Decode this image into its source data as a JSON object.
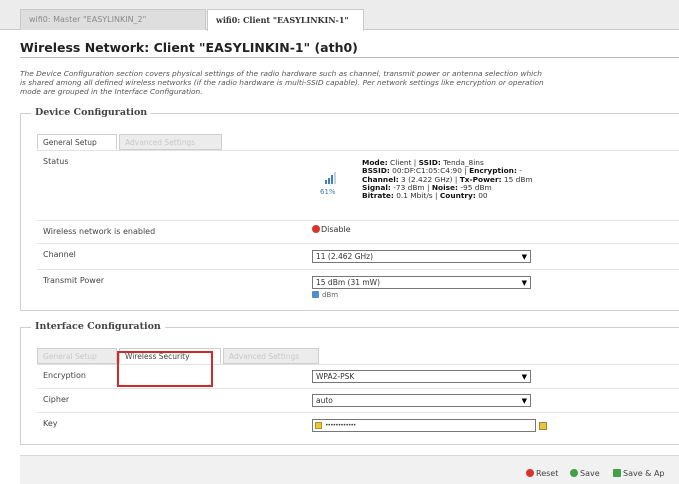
{
  "tabs": [
    {
      "label": "wifi0: Master \"EASYLINKIN_2\""
    },
    {
      "label": "wifi0: Client \"EASYLINKIN-1\""
    }
  ],
  "page_title": "Wireless Network: Client \"EASYLINKIN-1\" (ath0)",
  "intro_lines": [
    "The Device Configuration section covers physical settings of the radio hardware such as channel, transmit power or antenna selection which",
    "is shared among all defined wireless networks (if the radio hardware is multi-SSID capable). Per network settings like encryption or operation",
    "mode are grouped in the Interface Configuration."
  ],
  "device_config": {
    "legend": "Device Configuration",
    "subtabs": [
      "General Setup",
      "Advanced Settings"
    ],
    "status_label": "Status",
    "signal_percent": "61%",
    "status_lines": [
      {
        "k1": "Mode:",
        "v1": " Client | ",
        "k2": "SSID:",
        "v2": " Tenda_8ins"
      },
      {
        "k1": "BSSID:",
        "v1": " 00:DF:C1:05:C4:90 | ",
        "k2": "Encryption:",
        "v2": " -"
      },
      {
        "k1": "Channel:",
        "v1": " 3 (2.422 GHz) | ",
        "k2": "Tx-Power:",
        "v2": " 15 dBm"
      },
      {
        "k1": "Signal:",
        "v1": " -73 dBm | ",
        "k2": "Noise:",
        "v2": " -95 dBm"
      },
      {
        "k1": "Bitrate:",
        "v1": " 0.1 Mbit/s | ",
        "k2": "Country:",
        "v2": " 00"
      }
    ],
    "enabled_label": "Wireless network is enabled",
    "disable_button": "Disable",
    "channel_label": "Channel",
    "channel_value": "11 (2.462 GHz)",
    "txpower_label": "Transmit Power",
    "txpower_value": "15 dBm (31 mW)",
    "txpower_unit": "dBm"
  },
  "interface_config": {
    "legend": "Interface Configuration",
    "subtabs": [
      "General Setup",
      "Wireless Security",
      "Advanced Settings"
    ],
    "active_subtab_index": 1,
    "encryption_label": "Encryption",
    "encryption_value": "WPA2-PSK",
    "cipher_label": "Cipher",
    "cipher_value": "auto",
    "key_label": "Key",
    "key_mask": "••••••••••••"
  },
  "footer": {
    "reset_label": "Reset",
    "save_label": "Save",
    "save_apply_label": "Save & Ap"
  }
}
